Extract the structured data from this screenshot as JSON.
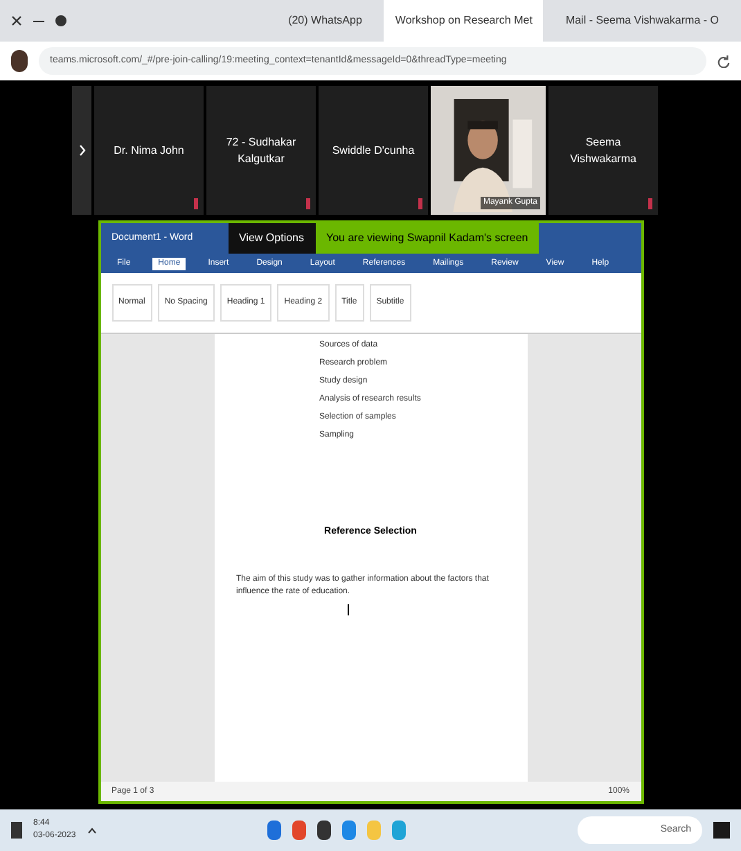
{
  "browser": {
    "tabs": [
      {
        "label": "(20) WhatsApp",
        "selected": false
      },
      {
        "label": "Workshop on Research Met",
        "selected": true
      },
      {
        "label": "Mail - Seema Vishwakarma - O",
        "selected": false
      }
    ],
    "address": "teams.microsoft.com/_#/pre-join-calling/19:meeting_context=tenantId&messageId=0&threadType=meeting"
  },
  "participants": [
    {
      "name": "Dr. Nima John",
      "video": false
    },
    {
      "name": "72 - Sudhakar Kalgutkar",
      "video": false
    },
    {
      "name": "Swiddle D'cunha",
      "video": false
    },
    {
      "name": "Mayank Gupta",
      "video": true
    },
    {
      "name": "Seema Vishwakarma",
      "video": false
    }
  ],
  "share_banner": {
    "label": "You are viewing Swapnil Kadam's screen",
    "view_options": "View Options"
  },
  "word": {
    "title": "Document1 - Word",
    "ribbon_tabs": [
      {
        "label": "File",
        "selected": false
      },
      {
        "label": "Home",
        "selected": true
      },
      {
        "label": "Insert",
        "selected": false
      },
      {
        "label": "Design",
        "selected": false
      },
      {
        "label": "Layout",
        "selected": false
      },
      {
        "label": "References",
        "selected": false
      },
      {
        "label": "Mailings",
        "selected": false
      },
      {
        "label": "Review",
        "selected": false
      },
      {
        "label": "View",
        "selected": false
      },
      {
        "label": "Help",
        "selected": false
      }
    ],
    "styles": [
      "Normal",
      "No Spacing",
      "Heading 1",
      "Heading 2",
      "Title",
      "Subtitle"
    ],
    "list": [
      "Sources of data",
      "Research problem",
      "Study design",
      "Analysis of research results",
      "Selection of samples",
      "Sampling"
    ],
    "heading": "Reference Selection",
    "paragraph": "The aim of this study was to gather information about the factors that influence the rate of education.",
    "status": "Page 1 of 3",
    "zoom": "100%"
  },
  "taskbar": {
    "time": "8:44",
    "date": "03-06-2023",
    "search": "Search"
  }
}
